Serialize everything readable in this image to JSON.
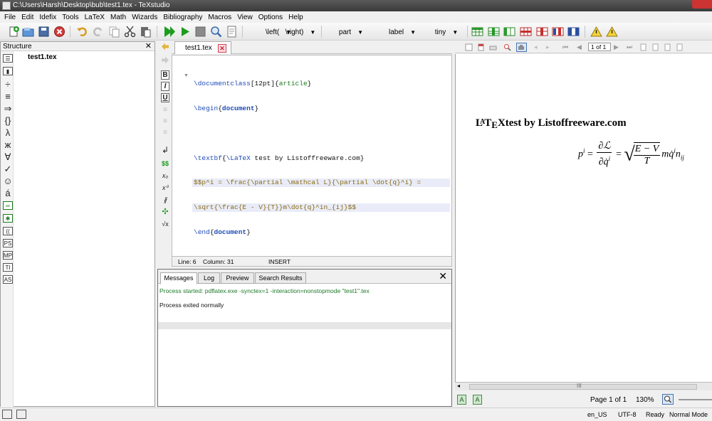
{
  "window": {
    "title": "C:\\Users\\Harsh\\Desktop\\bub\\test1.tex - TeXstudio"
  },
  "menu": [
    "File",
    "Edit",
    "Idefix",
    "Tools",
    "LaTeX",
    "Math",
    "Wizards",
    "Bibliography",
    "Macros",
    "View",
    "Options",
    "Help"
  ],
  "toolbar": {
    "left_delim": "\\left(",
    "right_delim": "\\right)",
    "sectioning": "part",
    "references": "label",
    "size": "tiny",
    "dropdown_arrow": "▼"
  },
  "structure": {
    "title": "Structure",
    "close": "✕",
    "root": "test1.tex"
  },
  "editor": {
    "tab_label": "test1.tex",
    "tab_close": "✕",
    "code": {
      "l1_cmd": "\\documentclass",
      "l1_opt": "[12pt]",
      "l1_lb": "{",
      "l1_arg": "article",
      "l1_rb": "}",
      "l2_cmd": "\\begin",
      "l2_lb": "{",
      "l2_arg": "document",
      "l2_rb": "}",
      "l4_cmd": "\\textbf",
      "l4_lb": "{",
      "l4_cmd2": "\\LaTeX",
      "l4_txt": " test by Listoffreeware.com",
      "l4_rb": "}",
      "l5": "$$p^i = \\frac{\\partial \\mathcal L}{\\partial \\dot{q}^i} =",
      "l6_a": "\\sqrt",
      "l6_b": "{\\frac{E - V}{T}}m\\dot{q}^in_{ij}$$",
      "l7_cmd": "\\end",
      "l7_lb": "{",
      "l7_arg": "document",
      "l7_rb": "}"
    },
    "status": {
      "line": "Line: 6",
      "column": "Column: 31",
      "mode": "INSERT"
    }
  },
  "messages": {
    "tabs": [
      "Messages",
      "Log",
      "Preview",
      "Search Results"
    ],
    "close": "✕",
    "line1": "Process started: pdflatex.exe -synctex=1 -interaction=nonstopmode \"test1\".tex",
    "line2": "Process exited normally"
  },
  "pdf": {
    "page_input": "1 of 1",
    "heading_la": "L",
    "heading_a": "A",
    "heading_t": "T",
    "heading_e": "E",
    "heading_x": "X",
    "heading_rest": "test by Listoffreeware.com",
    "eq": {
      "lhs": "p",
      "lhs_sup": "i",
      "eq1": "=",
      "frac1_num": "∂ℒ",
      "frac1_den": "∂q̇",
      "frac1_den_sup": "i",
      "eq2": "=",
      "sqrt": "√",
      "frac2_num": "E − V",
      "frac2_den": "T",
      "tail": "mq̇",
      "tail_sup": "i",
      "tail2": "n",
      "tail2_sub": "ij"
    },
    "scroll_label": "III",
    "page_status": "Page 1 of 1",
    "zoom": "130%"
  },
  "statusbar": {
    "language": "en_US",
    "encoding": "UTF-8",
    "state": "Ready",
    "mode": "Normal Mode"
  },
  "colors": {
    "accent_green": "#1f9b1f",
    "keyword_blue": "#1f4bb5",
    "argument_green": "#1c7a1c",
    "math_brown": "#8a6a12",
    "msg_green": "#1f7a2a"
  }
}
